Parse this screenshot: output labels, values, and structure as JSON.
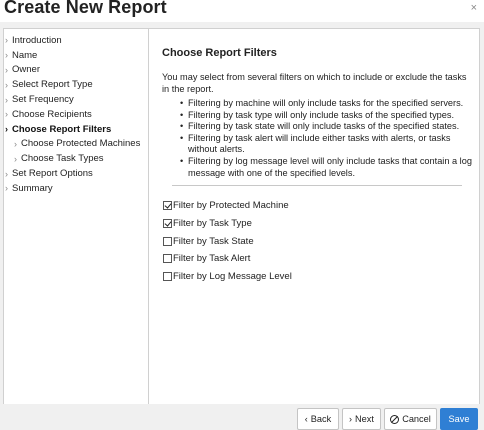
{
  "dialog": {
    "title": "Create New Report",
    "close_glyph": "×"
  },
  "sidebar": {
    "items": [
      {
        "label": "Introduction",
        "chevron": "›",
        "active": false,
        "sub": false
      },
      {
        "label": "Name",
        "chevron": "›",
        "active": false,
        "sub": false
      },
      {
        "label": "Owner",
        "chevron": "›",
        "active": false,
        "sub": false
      },
      {
        "label": "Select Report Type",
        "chevron": "›",
        "active": false,
        "sub": false
      },
      {
        "label": "Set Frequency",
        "chevron": "›",
        "active": false,
        "sub": false
      },
      {
        "label": "Choose Recipients",
        "chevron": "›",
        "active": false,
        "sub": false
      },
      {
        "label": "Choose Report Filters",
        "chevron": "›",
        "active": true,
        "sub": false
      },
      {
        "label": "Choose Protected Machines",
        "chevron": "›",
        "active": false,
        "sub": true
      },
      {
        "label": "Choose Task Types",
        "chevron": "›",
        "active": false,
        "sub": true
      },
      {
        "label": "Set Report Options",
        "chevron": "›",
        "active": false,
        "sub": false
      },
      {
        "label": "Summary",
        "chevron": "›",
        "active": false,
        "sub": false
      }
    ]
  },
  "main": {
    "title": "Choose Report Filters",
    "intro": "You may select from several filters on which to include or exclude the tasks in the report.",
    "bullets": [
      "Filtering by machine will only include tasks for the specified servers.",
      "Filtering by task type will only include tasks of the specified types.",
      "Filtering by task state will only include tasks of the specified states.",
      "Filtering by task alert will include either tasks with alerts, or tasks without alerts.",
      "Filtering by log message level will only include tasks that contain a log message with one of the specified levels."
    ],
    "filters": [
      {
        "label": "Filter by Protected Machine",
        "checked": true
      },
      {
        "label": "Filter by Task Type",
        "checked": true
      },
      {
        "label": "Filter by Task State",
        "checked": false
      },
      {
        "label": "Filter by Task Alert",
        "checked": false
      },
      {
        "label": "Filter by Log Message Level",
        "checked": false
      }
    ]
  },
  "footer": {
    "back_label": "Back",
    "back_glyph": "‹",
    "next_label": "Next",
    "next_glyph": "›",
    "cancel_label": "Cancel",
    "save_label": "Save",
    "save_color": "#2f7fd4"
  }
}
